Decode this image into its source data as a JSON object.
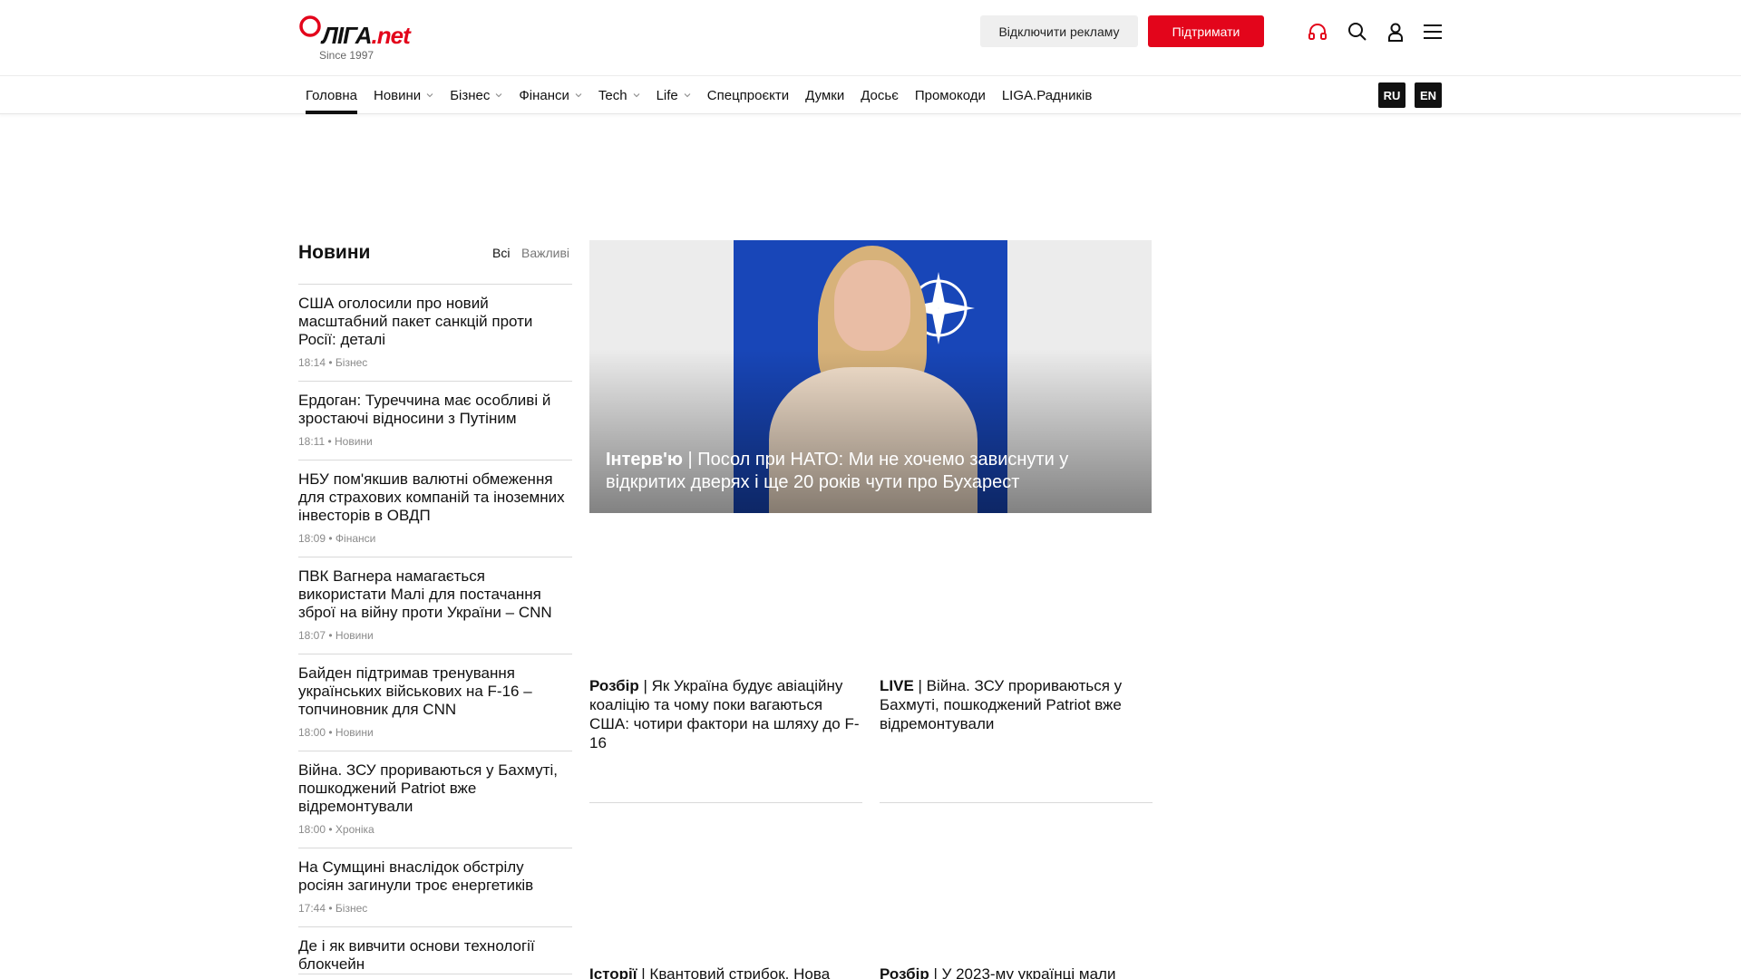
{
  "header": {
    "logo_text_a": "ЛІГА",
    "logo_text_b": ".net",
    "logo_since": "Since 1997",
    "disable_ads_label": "Відключити рекламу",
    "support_label": "Підтримати",
    "brand_color": "#e3051b",
    "icons": [
      "headphones-icon",
      "search-icon",
      "user-icon",
      "menu-icon"
    ]
  },
  "nav": {
    "items": [
      {
        "label": "Головна",
        "dropdown": false,
        "active": true
      },
      {
        "label": "Новини",
        "dropdown": true
      },
      {
        "label": "Бізнес",
        "dropdown": true
      },
      {
        "label": "Фінанси",
        "dropdown": true
      },
      {
        "label": "Tech",
        "dropdown": true
      },
      {
        "label": "Life",
        "dropdown": true
      },
      {
        "label": "Спецпроєкти",
        "dropdown": false
      },
      {
        "label": "Думки",
        "dropdown": false
      },
      {
        "label": "Досьє",
        "dropdown": false
      },
      {
        "label": "Промокоди",
        "dropdown": false
      },
      {
        "label": "LIGA.Радників",
        "dropdown": false
      }
    ],
    "lang_ru": "RU",
    "lang_en": "EN"
  },
  "news": {
    "title": "Новини",
    "filter_all": "Всі",
    "filter_important": "Важливі",
    "items": [
      {
        "title": "США оголосили про новий масштабний пакет санкцій проти Росії: деталі",
        "meta": "18:14 • Бізнес"
      },
      {
        "title": "Ердоган: Туреччина має особливі й зростаючі відносини з Путіним",
        "meta": "18:11 • Новини"
      },
      {
        "title": "НБУ пом'якшив валютні обмеження для страхових компаній та іноземних інвесторів в ОВДП",
        "meta": "18:09 • Фінанси"
      },
      {
        "title": "ПВК Вагнера намагається використати Малі для постачання зброї на війну проти України – CNN",
        "meta": "18:07 • Новини"
      },
      {
        "title": "Байден підтримав тренування українських військових на F-16 – топчиновник для CNN",
        "meta": "18:00 • Новини"
      },
      {
        "title": "Війна. ЗСУ прориваються у Бахмуті, пошкоджений Patriot вже відремонтували",
        "meta": "18:00 • Хроніка"
      },
      {
        "title": "На Сумщині внаслідок обстрілу росіян загинули троє енергетиків",
        "meta": "17:44 • Бізнес"
      },
      {
        "title": "Де і як вивчити основи технології блокчейн",
        "meta": ""
      }
    ]
  },
  "hero": {
    "tag": "Інтерв'ю",
    "title": " | Посол при НАТО: Ми не хочемо зависнути у відкритих дверях і ще 20 років чути про Бухарест"
  },
  "tiles": [
    {
      "tag": "Розбір",
      "title": " | Як Україна будує авіаційну коаліцію та чому поки вагаються США: чотири фактори на шляху до F-16"
    },
    {
      "tag": "LIVE",
      "title": " | Війна. ЗСУ прориваються у Бахмуті, пошкоджений Patriot вже відремонтували"
    },
    {
      "tag": "Історії",
      "title": " | Квантовий стрибок. Нова"
    },
    {
      "tag": "Розбір",
      "title": " | У 2023-му українці мали"
    }
  ]
}
